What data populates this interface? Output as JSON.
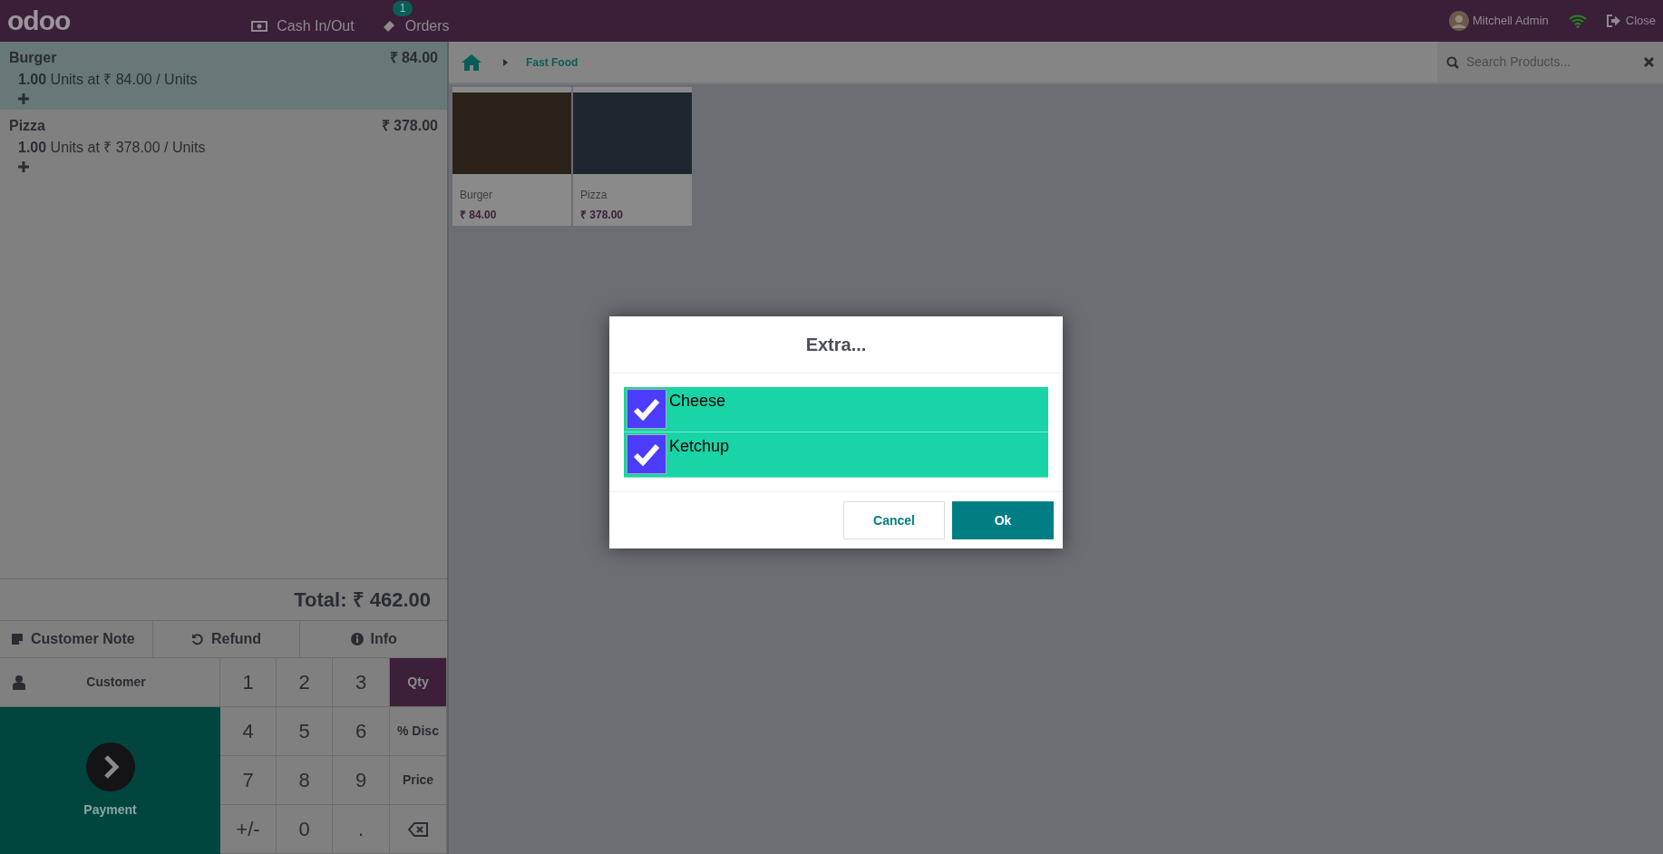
{
  "topbar": {
    "logo": "odoo",
    "buttons": [
      {
        "label": "Cash In/Out",
        "kind": "cash"
      },
      {
        "label": "Orders",
        "kind": "orders",
        "badge": "1"
      }
    ],
    "user": "Mitchell Admin",
    "close": "Close"
  },
  "order": {
    "lines": [
      {
        "name": "Burger",
        "price": "₹ 84.00",
        "qty": "1.00",
        "detail": "Units at ₹ 84.00 / Units",
        "selected": true
      },
      {
        "name": "Pizza",
        "price": "₹ 378.00",
        "qty": "1.00",
        "detail": "Units at ₹ 378.00 / Units",
        "selected": false
      }
    ],
    "total": "Total: ₹ 462.00"
  },
  "actions": [
    {
      "label": "Customer Note",
      "kind": "note"
    },
    {
      "label": "Refund",
      "kind": "refund"
    },
    {
      "label": "Info",
      "kind": "info"
    }
  ],
  "customer": "Customer",
  "payment": "Payment",
  "numpad": [
    {
      "label": "1",
      "kind": "digit"
    },
    {
      "label": "2",
      "kind": "digit"
    },
    {
      "label": "3",
      "kind": "digit"
    },
    {
      "label": "Qty",
      "kind": "mode",
      "selected": true
    },
    {
      "label": "4",
      "kind": "digit"
    },
    {
      "label": "5",
      "kind": "digit"
    },
    {
      "label": "6",
      "kind": "digit"
    },
    {
      "label": "% Disc",
      "kind": "mode",
      "selected": false
    },
    {
      "label": "7",
      "kind": "digit"
    },
    {
      "label": "8",
      "kind": "digit"
    },
    {
      "label": "9",
      "kind": "digit"
    },
    {
      "label": "Price",
      "kind": "mode",
      "selected": false
    },
    {
      "label": "+/-",
      "kind": "digit"
    },
    {
      "label": "0",
      "kind": "digit"
    },
    {
      "label": ".",
      "kind": "digit"
    },
    {
      "kind": "backspace"
    }
  ],
  "breadcrumb": {
    "category": "Fast Food"
  },
  "search": {
    "placeholder": "Search Products..."
  },
  "products": [
    {
      "name": "Burger",
      "price": "₹ 84.00"
    },
    {
      "name": "Pizza",
      "price": "₹ 378.00"
    }
  ],
  "dialog": {
    "title": "Extra...",
    "options": [
      {
        "label": "Cheese",
        "checked": true
      },
      {
        "label": "Ketchup",
        "checked": true
      }
    ],
    "buttons": [
      {
        "label": "Cancel",
        "kind": "secondary"
      },
      {
        "label": "Ok",
        "kind": "primary"
      }
    ]
  }
}
